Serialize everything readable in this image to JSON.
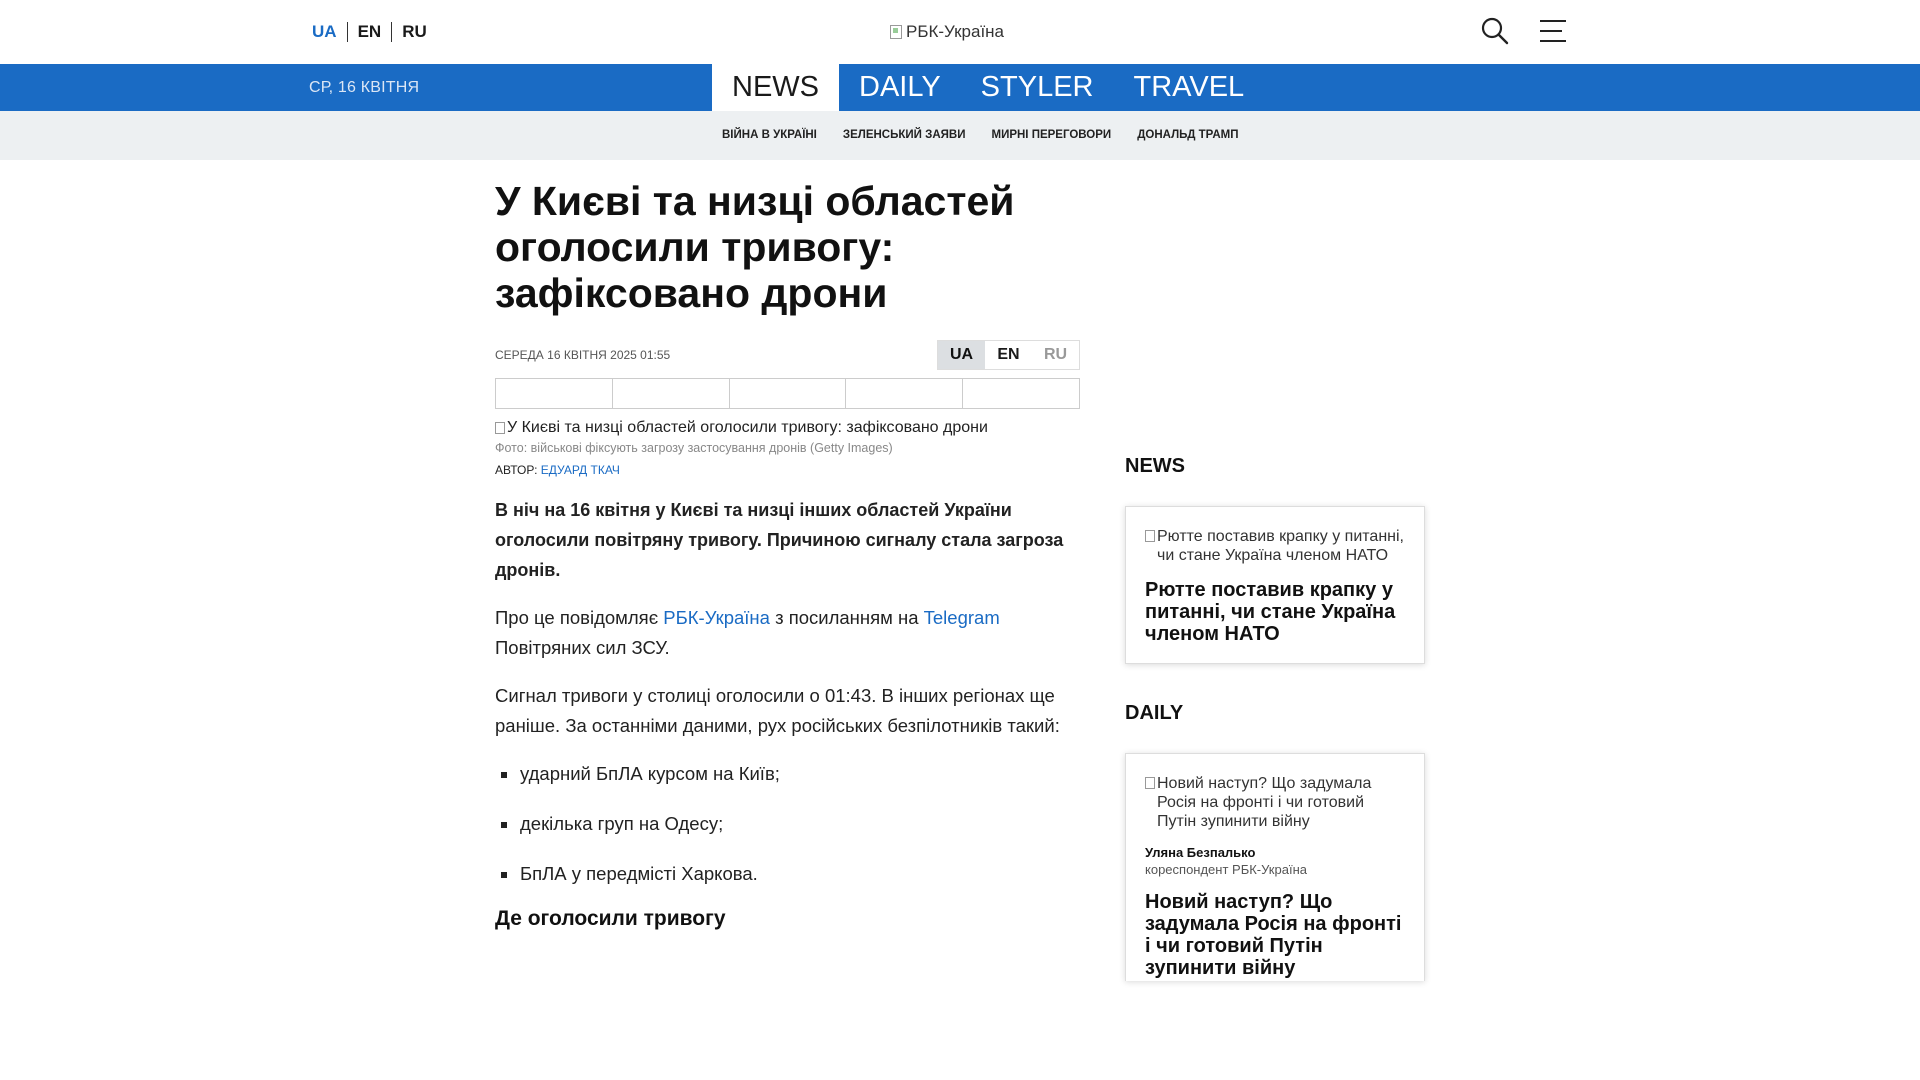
{
  "header": {
    "langs": [
      "UA",
      "EN",
      "RU"
    ],
    "active_lang": "UA",
    "logo_alt": "РБК-Україна"
  },
  "navbar": {
    "date": "СР, 16 КВІТНЯ",
    "sections": [
      "NEWS",
      "DAILY",
      "STYLER",
      "TRAVEL"
    ]
  },
  "tags": [
    "ВІЙНА В УКРАЇНІ",
    "ЗЕЛЕНСЬКИЙ ЗАЯВИ",
    "МИРНІ ПЕРЕГОВОРИ",
    "ДОНАЛЬД ТРАМП"
  ],
  "article": {
    "headline": "У Києві та низці областей оголосили тривогу: зафіксовано дрони",
    "pubdate": "СЕРЕДА 16 КВІТНЯ 2025 01:55",
    "langs": [
      "UA",
      "EN",
      "RU"
    ],
    "photo_alt": "У Києві та низці областей оголосили тривогу: зафіксовано дрони",
    "caption": "Фото: військові фіксують загрозу застосування дронів (Getty Images)",
    "author_label": "АВТОР:",
    "author_name": "ЕДУАРД ТКАЧ",
    "lead": "В ніч на 16 квітня у Києві та низці інших областей України оголосили повітряну тривогу. Причиною сигналу стала загроза дронів.",
    "p1_start": "Про це повідомляє ",
    "p1_link1": "РБК-Україна",
    "p1_mid": " з посиланням на ",
    "p1_link2": "Telegram",
    "p1_end": " Повітряних сил ЗСУ.",
    "p2": "Сигнал тривоги у столиці оголосили о 01:43. В інших регіонах ще раніше. За останніми даними, рух російських безпілотників такий:",
    "bullets": [
      "ударний БпЛА курсом на Київ;",
      "декілька груп на Одесу;",
      "БпЛА у передмісті Харкова."
    ],
    "subhead": "Де оголосили тривогу"
  },
  "sidebar": {
    "news_title": "NEWS",
    "news_card": {
      "img_alt": "Рютте поставив крапку у питанні, чи стане Україна членом НАТО",
      "title": "Рютте поставив крапку у питанні, чи стане Україна членом НАТО"
    },
    "daily_title": "DAILY",
    "daily_card": {
      "img_alt": "Новий наступ? Що задумала Росія на фронті і чи готовий Путін зупинити війну",
      "author": "Уляна Безпалько",
      "role": "кореспондент РБК-Україна",
      "title": "Новий наступ? Що задумала Росія на фронті і чи готовий Путін зупинити війну"
    }
  },
  "colors": {
    "brand_blue": "#1a6bc4",
    "tags_bg": "#edf0f2"
  },
  "icons": [
    "search-icon",
    "hamburger-menu-icon",
    "broken-image-icon"
  ]
}
